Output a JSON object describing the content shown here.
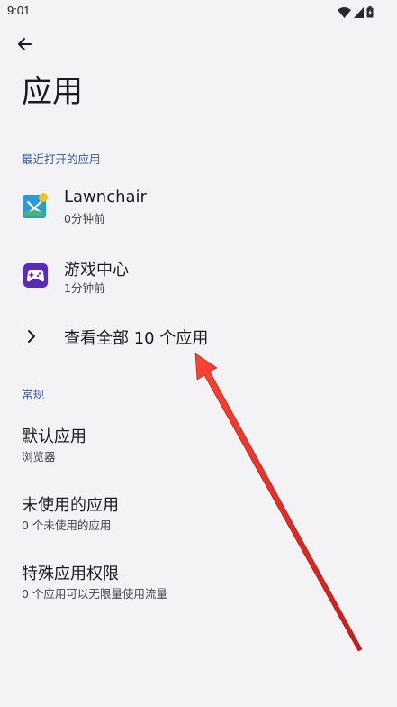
{
  "status_bar": {
    "time": "9:01",
    "icons": [
      "wifi-icon",
      "signal-icon",
      "battery-icon"
    ]
  },
  "header": {
    "back_icon": "back-arrow-icon",
    "title": "应用"
  },
  "recent": {
    "section_label": "最近打开的应用",
    "apps": [
      {
        "name": "Lawnchair",
        "time": "0分钟前",
        "icon": "lawnchair-icon"
      },
      {
        "name": "游戏中心",
        "time": "1分钟前",
        "icon": "game-center-icon"
      }
    ],
    "see_all_label": "查看全部 10 个应用"
  },
  "general": {
    "section_label": "常规",
    "items": [
      {
        "title": "默认应用",
        "subtitle": "浏览器"
      },
      {
        "title": "未使用的应用",
        "subtitle": "0 个未使用的应用"
      },
      {
        "title": "特殊应用权限",
        "subtitle": "0 个应用可以无限量使用流量"
      }
    ]
  },
  "colors": {
    "background": "#f3f3f5",
    "section_header": "#3a5aa8",
    "annotation_arrow": "#e8201e"
  }
}
